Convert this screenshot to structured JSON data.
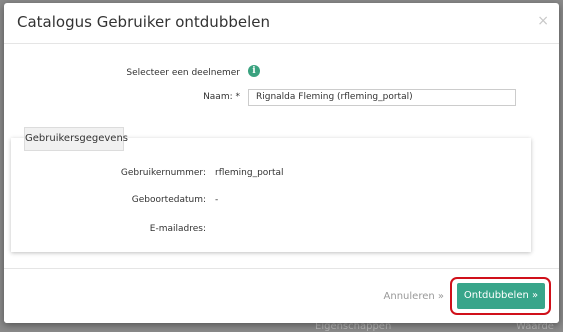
{
  "background": {
    "left_text": "Eigenschappen",
    "right_text": "Waarde"
  },
  "modal": {
    "title": "Catalogus Gebruiker ontdubbelen",
    "close_label": "×",
    "select_label": "Selecteer een deelnemer",
    "info_icon_glyph": "i",
    "name_label": "Naam: *",
    "name_value": "Rignalda Fleming (rfleming_portal)",
    "panel_title": "Gebruikersgegevens",
    "fields": [
      {
        "label": "Gebruikernummer:",
        "value": "rfleming_portal"
      },
      {
        "label": "Geboortedatum:",
        "value": "-"
      },
      {
        "label": "E-mailadres:",
        "value": ""
      }
    ],
    "cancel_label": "Annuleren »",
    "submit_label": "Ontdubbelen »"
  },
  "colors": {
    "accent": "#38a58a",
    "highlight": "#d0101a",
    "info_icon": "#3aa27f"
  }
}
